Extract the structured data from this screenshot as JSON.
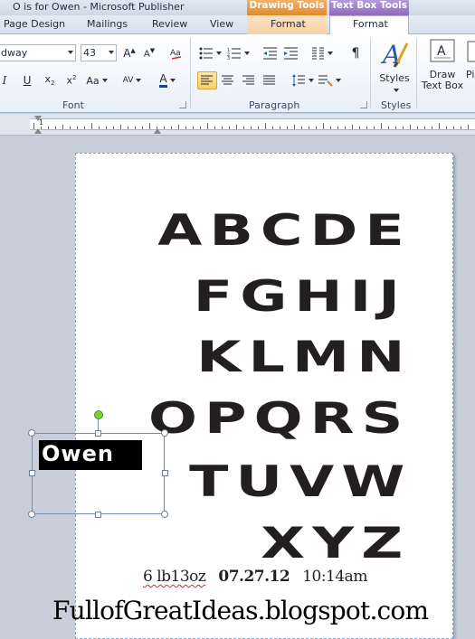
{
  "window": {
    "title": "O is for Owen  -  Microsoft Publisher"
  },
  "contextual_tabs": {
    "drawing_tools": "Drawing Tools",
    "text_box_tools": "Text Box Tools"
  },
  "tabs": [
    {
      "label": "Page Design"
    },
    {
      "label": "Mailings"
    },
    {
      "label": "Review"
    },
    {
      "label": "View"
    },
    {
      "label": "Format"
    },
    {
      "label": "Format"
    }
  ],
  "ribbon": {
    "font_group": {
      "label": "Font",
      "font_name": "dway",
      "font_size": "43"
    },
    "paragraph_group": {
      "label": "Paragraph"
    },
    "styles_group": {
      "label": "Styles",
      "styles_button": "Styles"
    },
    "draw_text_box": {
      "line1": "Draw",
      "line2": "Text Box"
    },
    "partial_button": "Pi"
  },
  "ruler": {
    "numbers": [
      "1"
    ]
  },
  "document": {
    "alphabet_lines": [
      "ABCDE",
      "FGHIJ",
      "KLMN",
      "OPQRS",
      "TUVW",
      "XYZ"
    ],
    "selected_textbox_text": "Owen",
    "date_line": {
      "weight": "6 lb13oz",
      "date": "07.27.12",
      "time": "10:14am"
    },
    "watermark": "FullofGreatIdeas.blogspot.com"
  },
  "colors": {
    "drawing_tools_accent": "#e08b2a",
    "text_box_tools_accent": "#8e69c0",
    "letter_color": "#231f20",
    "rotate_handle": "#7ed03a"
  }
}
